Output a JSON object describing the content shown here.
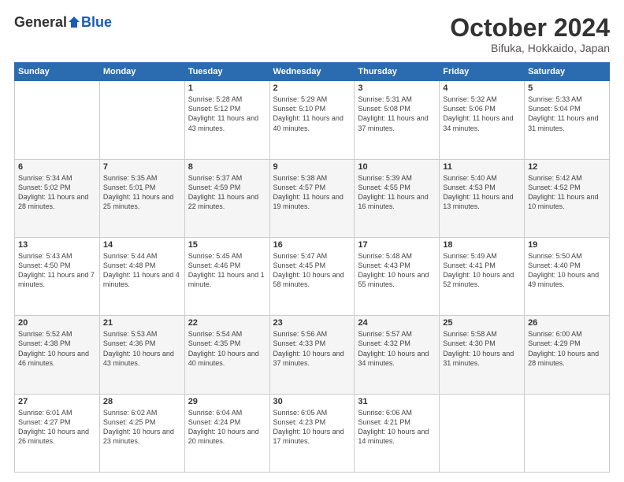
{
  "header": {
    "logo": {
      "general": "General",
      "blue": "Blue"
    },
    "title": "October 2024",
    "subtitle": "Bifuka, Hokkaido, Japan"
  },
  "weekdays": [
    "Sunday",
    "Monday",
    "Tuesday",
    "Wednesday",
    "Thursday",
    "Friday",
    "Saturday"
  ],
  "weeks": [
    [
      {
        "day": "",
        "info": ""
      },
      {
        "day": "",
        "info": ""
      },
      {
        "day": "1",
        "info": "Sunrise: 5:28 AM\nSunset: 5:12 PM\nDaylight: 11 hours and 43 minutes."
      },
      {
        "day": "2",
        "info": "Sunrise: 5:29 AM\nSunset: 5:10 PM\nDaylight: 11 hours and 40 minutes."
      },
      {
        "day": "3",
        "info": "Sunrise: 5:31 AM\nSunset: 5:08 PM\nDaylight: 11 hours and 37 minutes."
      },
      {
        "day": "4",
        "info": "Sunrise: 5:32 AM\nSunset: 5:06 PM\nDaylight: 11 hours and 34 minutes."
      },
      {
        "day": "5",
        "info": "Sunrise: 5:33 AM\nSunset: 5:04 PM\nDaylight: 11 hours and 31 minutes."
      }
    ],
    [
      {
        "day": "6",
        "info": "Sunrise: 5:34 AM\nSunset: 5:02 PM\nDaylight: 11 hours and 28 minutes."
      },
      {
        "day": "7",
        "info": "Sunrise: 5:35 AM\nSunset: 5:01 PM\nDaylight: 11 hours and 25 minutes."
      },
      {
        "day": "8",
        "info": "Sunrise: 5:37 AM\nSunset: 4:59 PM\nDaylight: 11 hours and 22 minutes."
      },
      {
        "day": "9",
        "info": "Sunrise: 5:38 AM\nSunset: 4:57 PM\nDaylight: 11 hours and 19 minutes."
      },
      {
        "day": "10",
        "info": "Sunrise: 5:39 AM\nSunset: 4:55 PM\nDaylight: 11 hours and 16 minutes."
      },
      {
        "day": "11",
        "info": "Sunrise: 5:40 AM\nSunset: 4:53 PM\nDaylight: 11 hours and 13 minutes."
      },
      {
        "day": "12",
        "info": "Sunrise: 5:42 AM\nSunset: 4:52 PM\nDaylight: 11 hours and 10 minutes."
      }
    ],
    [
      {
        "day": "13",
        "info": "Sunrise: 5:43 AM\nSunset: 4:50 PM\nDaylight: 11 hours and 7 minutes."
      },
      {
        "day": "14",
        "info": "Sunrise: 5:44 AM\nSunset: 4:48 PM\nDaylight: 11 hours and 4 minutes."
      },
      {
        "day": "15",
        "info": "Sunrise: 5:45 AM\nSunset: 4:46 PM\nDaylight: 11 hours and 1 minute."
      },
      {
        "day": "16",
        "info": "Sunrise: 5:47 AM\nSunset: 4:45 PM\nDaylight: 10 hours and 58 minutes."
      },
      {
        "day": "17",
        "info": "Sunrise: 5:48 AM\nSunset: 4:43 PM\nDaylight: 10 hours and 55 minutes."
      },
      {
        "day": "18",
        "info": "Sunrise: 5:49 AM\nSunset: 4:41 PM\nDaylight: 10 hours and 52 minutes."
      },
      {
        "day": "19",
        "info": "Sunrise: 5:50 AM\nSunset: 4:40 PM\nDaylight: 10 hours and 49 minutes."
      }
    ],
    [
      {
        "day": "20",
        "info": "Sunrise: 5:52 AM\nSunset: 4:38 PM\nDaylight: 10 hours and 46 minutes."
      },
      {
        "day": "21",
        "info": "Sunrise: 5:53 AM\nSunset: 4:36 PM\nDaylight: 10 hours and 43 minutes."
      },
      {
        "day": "22",
        "info": "Sunrise: 5:54 AM\nSunset: 4:35 PM\nDaylight: 10 hours and 40 minutes."
      },
      {
        "day": "23",
        "info": "Sunrise: 5:56 AM\nSunset: 4:33 PM\nDaylight: 10 hours and 37 minutes."
      },
      {
        "day": "24",
        "info": "Sunrise: 5:57 AM\nSunset: 4:32 PM\nDaylight: 10 hours and 34 minutes."
      },
      {
        "day": "25",
        "info": "Sunrise: 5:58 AM\nSunset: 4:30 PM\nDaylight: 10 hours and 31 minutes."
      },
      {
        "day": "26",
        "info": "Sunrise: 6:00 AM\nSunset: 4:29 PM\nDaylight: 10 hours and 28 minutes."
      }
    ],
    [
      {
        "day": "27",
        "info": "Sunrise: 6:01 AM\nSunset: 4:27 PM\nDaylight: 10 hours and 26 minutes."
      },
      {
        "day": "28",
        "info": "Sunrise: 6:02 AM\nSunset: 4:25 PM\nDaylight: 10 hours and 23 minutes."
      },
      {
        "day": "29",
        "info": "Sunrise: 6:04 AM\nSunset: 4:24 PM\nDaylight: 10 hours and 20 minutes."
      },
      {
        "day": "30",
        "info": "Sunrise: 6:05 AM\nSunset: 4:23 PM\nDaylight: 10 hours and 17 minutes."
      },
      {
        "day": "31",
        "info": "Sunrise: 6:06 AM\nSunset: 4:21 PM\nDaylight: 10 hours and 14 minutes."
      },
      {
        "day": "",
        "info": ""
      },
      {
        "day": "",
        "info": ""
      }
    ]
  ]
}
